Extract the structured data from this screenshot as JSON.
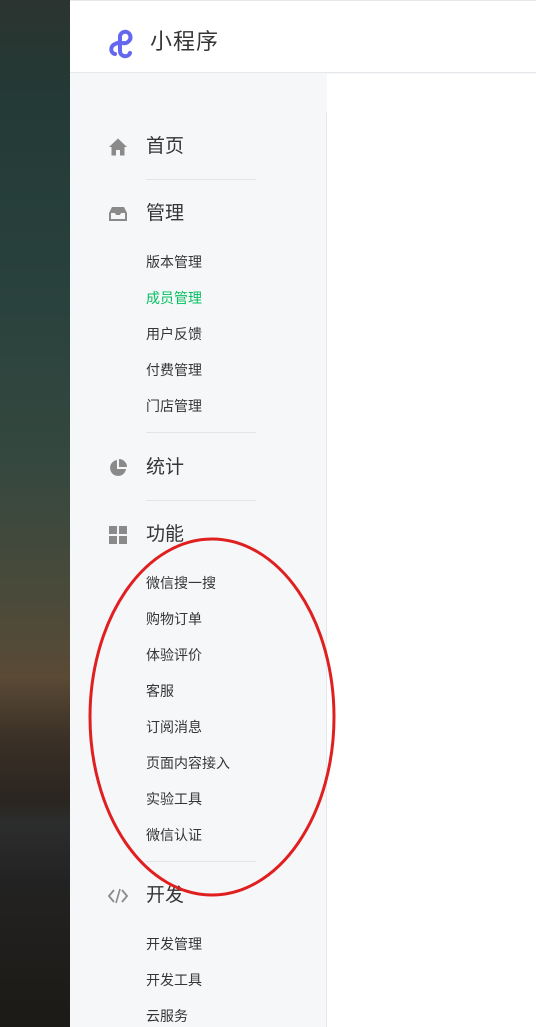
{
  "app": {
    "title": "小程序"
  },
  "nav": {
    "home": {
      "label": "首页"
    },
    "manage": {
      "label": "管理",
      "items": [
        "版本管理",
        "成员管理",
        "用户反馈",
        "付费管理",
        "门店管理"
      ],
      "active_item": "成员管理"
    },
    "stats": {
      "label": "统计"
    },
    "features": {
      "label": "功能",
      "items": [
        "微信搜一搜",
        "购物订单",
        "体验评价",
        "客服",
        "订阅消息",
        "页面内容接入",
        "实验工具",
        "微信认证"
      ]
    },
    "dev": {
      "label": "开发",
      "items": [
        "开发管理",
        "开发工具",
        "云服务"
      ]
    }
  },
  "colors": {
    "accent_active": "#07c160",
    "annotation": "#e02020",
    "logo": "#6467f0"
  },
  "icons": {
    "logo": "mini-program-logo-icon",
    "home": "home-icon",
    "manage": "inbox-icon",
    "stats": "pie-chart-icon",
    "features": "grid-icon",
    "dev": "code-icon"
  }
}
